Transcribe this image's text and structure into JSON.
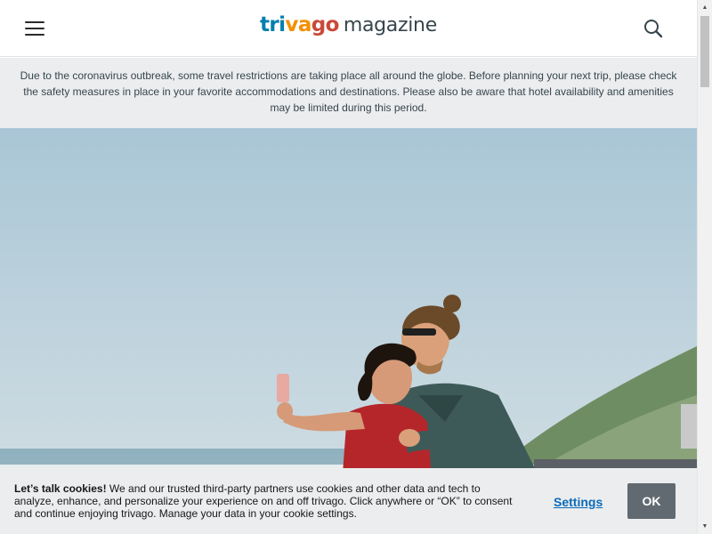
{
  "header": {
    "logo": {
      "brand_part1": "tri",
      "brand_part2": "va",
      "brand_part3": "go",
      "word": "magazine"
    },
    "icons": {
      "menu": "hamburger-menu-icon",
      "search": "search-icon"
    }
  },
  "notice": {
    "text": "Due to the coronavirus outbreak, some travel restrictions are taking place all around the globe. Before planning your next trip, please check the safety measures in place in your favorite accommodations and destinations. Please also be aware that hotel availability and amenities may be limited during this period."
  },
  "hero": {
    "image": "couple-selfie-by-the-sea-photo"
  },
  "cookie_banner": {
    "heading": "Let’s talk cookies!",
    "body": " We and our trusted third-party partners use cookies and other data and tech to analyze, enhance, and personalize your experience on and off trivago. Click anywhere or “OK” to consent and continue enjoying trivago. Manage your data in your cookie settings.",
    "settings_label": "Settings",
    "ok_label": "OK"
  },
  "colors": {
    "brand_blue": "#007faf",
    "brand_orange": "#f48f00",
    "brand_red": "#c94a38",
    "notice_bg": "#ebedee",
    "link_blue": "#0a6ab8",
    "ok_button": "#606a70"
  }
}
